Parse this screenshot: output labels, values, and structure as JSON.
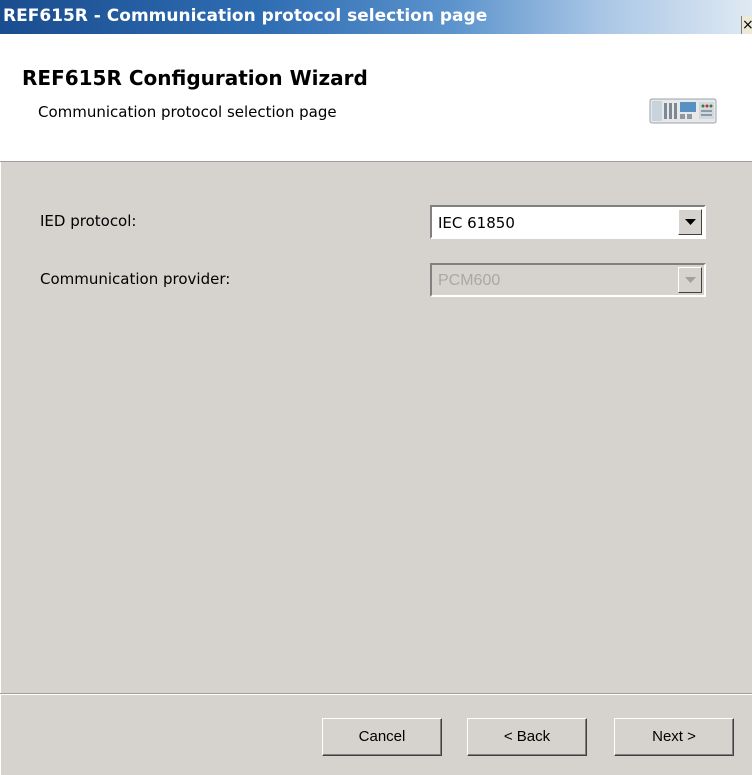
{
  "window": {
    "title": "REF615R - Communication protocol selection page",
    "close_glyph": "×"
  },
  "header": {
    "title": "REF615R Configuration Wizard",
    "subtitle": "Communication protocol selection page",
    "icon": "relay-device-icon"
  },
  "form": {
    "ied_protocol": {
      "label": "IED protocol:",
      "value": "IEC 61850",
      "enabled": true
    },
    "communication_provider": {
      "label": "Communication provider:",
      "value": "PCM600",
      "enabled": false
    }
  },
  "buttons": {
    "cancel": "Cancel",
    "back": "< Back",
    "next": "Next >"
  },
  "colors": {
    "title_bar_start": "#1a4d8f",
    "title_bar_end": "#dfe9f3",
    "dialog_background": "#d6d3ce",
    "header_background": "#ffffff",
    "disabled_text": "#a8a8a8"
  }
}
